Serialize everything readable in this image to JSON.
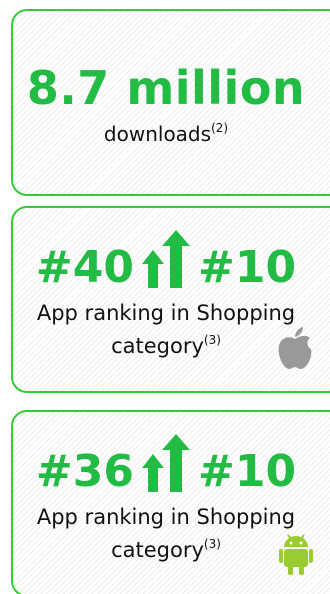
{
  "downloads": {
    "value": "8.7 million",
    "label": "downloads",
    "footnote": "(2)"
  },
  "ios_ranking": {
    "from": "#40",
    "to": "#10",
    "label_line1": "App ranking in Shopping",
    "label_line2": "category",
    "footnote": "(3)",
    "platform_icon": "apple-icon"
  },
  "android_ranking": {
    "from": "#36",
    "to": "#10",
    "label_line1": "App ranking in Shopping",
    "label_line2": "category",
    "footnote": "(3)",
    "platform_icon": "android-icon"
  },
  "colors": {
    "accent_green": "#22bb44",
    "border_green": "#33cc33",
    "apple_gray": "#999999",
    "android_green": "#99cc33"
  }
}
